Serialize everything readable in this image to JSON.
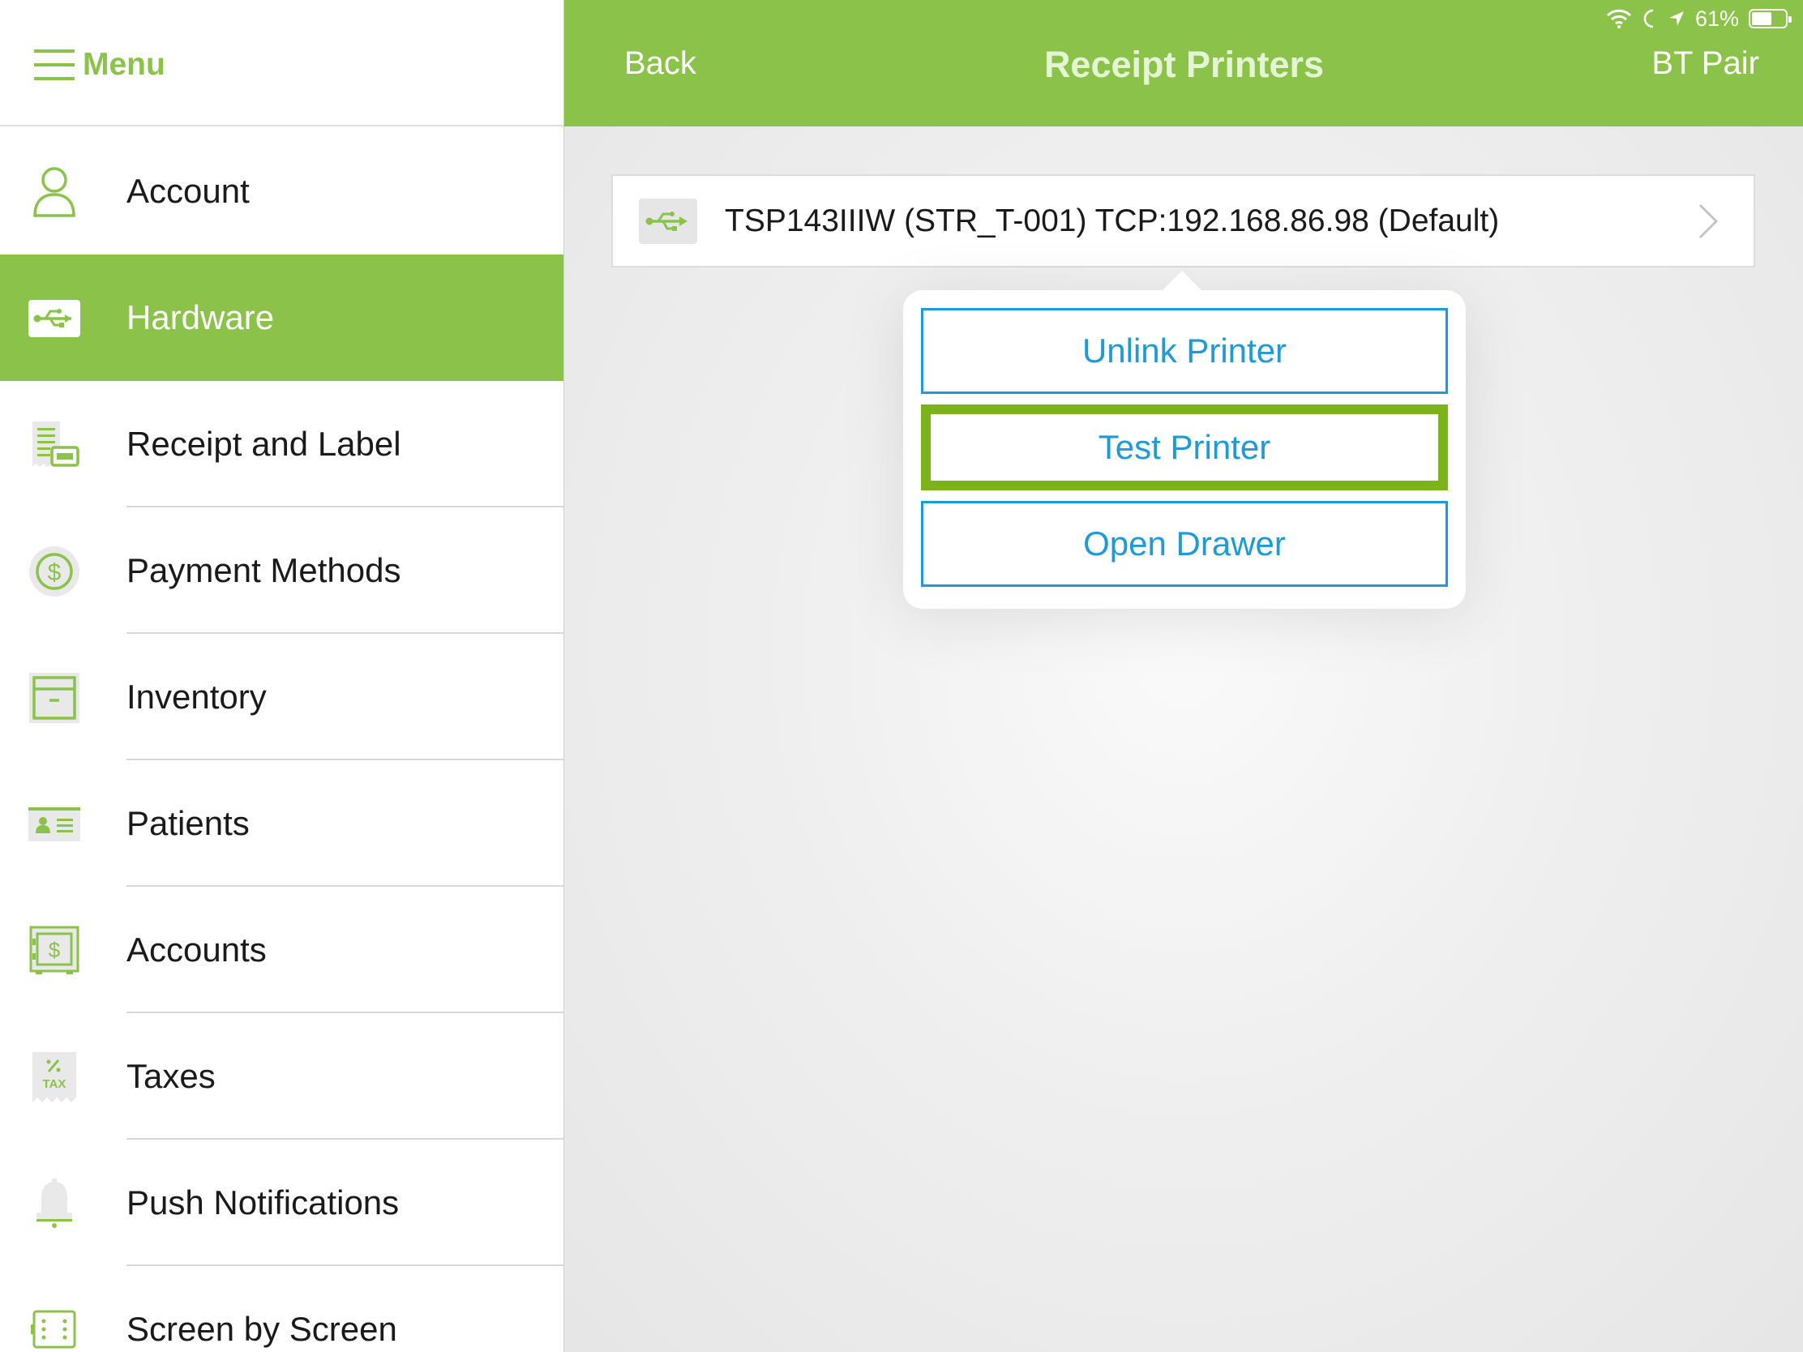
{
  "status_bar": {
    "battery_text": "61%",
    "battery_level": 0.61
  },
  "sidebar": {
    "menu_label": "Menu",
    "items": [
      {
        "label": "Account",
        "icon": "person-icon"
      },
      {
        "label": "Hardware",
        "icon": "usb-icon",
        "active": true
      },
      {
        "label": "Receipt and Label",
        "icon": "receipt-icon"
      },
      {
        "label": "Payment Methods",
        "icon": "dollar-circle-icon"
      },
      {
        "label": "Inventory",
        "icon": "archive-box-icon"
      },
      {
        "label": "Patients",
        "icon": "id-card-icon"
      },
      {
        "label": "Accounts",
        "icon": "safe-icon"
      },
      {
        "label": "Taxes",
        "icon": "tax-receipt-icon"
      },
      {
        "label": "Push Notifications",
        "icon": "bell-icon"
      },
      {
        "label": "Screen by Screen",
        "icon": "screen-grid-icon"
      }
    ]
  },
  "nav": {
    "back_label": "Back",
    "title": "Receipt Printers",
    "right_label": "BT Pair"
  },
  "printer": {
    "name": "TSP143IIIW (STR_T-001) TCP:192.168.86.98 (Default)",
    "icon": "usb-icon"
  },
  "popover": {
    "buttons": [
      {
        "label": "Unlink Printer"
      },
      {
        "label": "Test Printer",
        "highlighted": true
      },
      {
        "label": "Open Drawer"
      }
    ]
  },
  "colors": {
    "brand_green": "#8bc34a",
    "highlight_green": "#7cb31a",
    "link_blue": "#1e9ad6"
  }
}
